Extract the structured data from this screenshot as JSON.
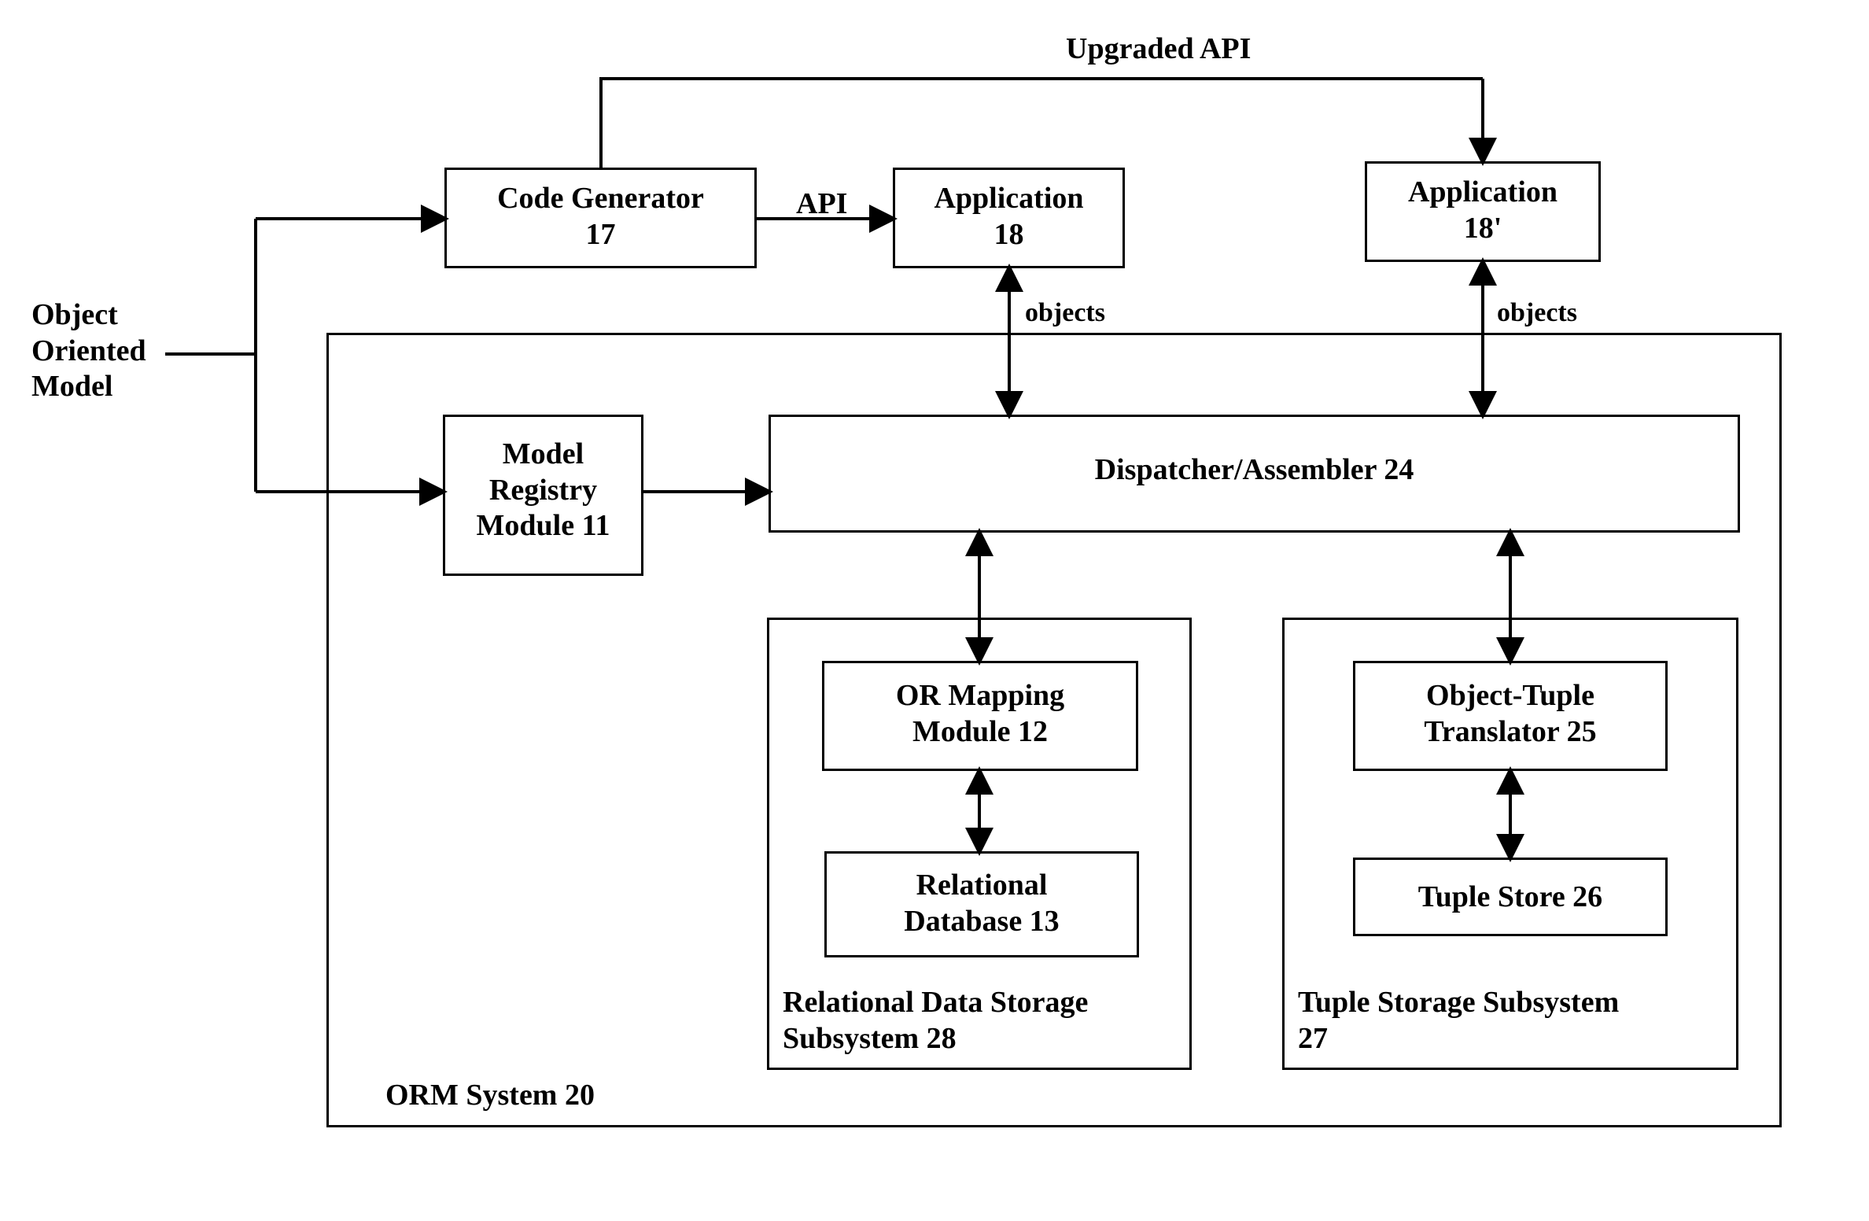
{
  "labels": {
    "oom": "Object\nOriented\nModel",
    "upgraded_api": "Upgraded API",
    "api": "API",
    "objects1": "objects",
    "objects2": "objects"
  },
  "blocks": {
    "code_generator": "Code Generator\n17",
    "application": "Application\n18",
    "application_prime": "Application\n18'",
    "model_registry": "Model\nRegistry\nModule 11",
    "dispatcher": "Dispatcher/Assembler 24",
    "or_mapping": "OR Mapping\nModule 12",
    "relational_db": "Relational\nDatabase 13",
    "object_tuple": "Object-Tuple\nTranslator 25",
    "tuple_store": "Tuple Store 26",
    "rel_subsystem": "Relational Data Storage\nSubsystem 28",
    "tuple_subsystem": "Tuple Storage Subsystem\n27",
    "orm_system": "ORM System 20"
  }
}
